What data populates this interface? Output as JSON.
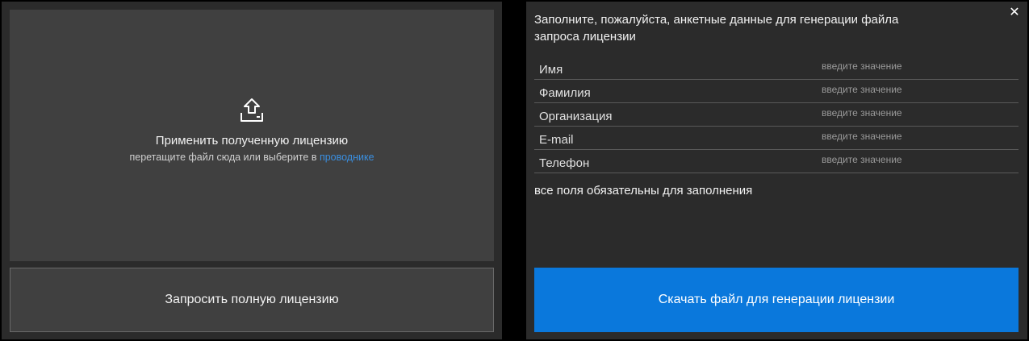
{
  "left_panel": {
    "dropzone": {
      "icon": "upload-icon",
      "title": "Применить полученную лицензию",
      "hint": "перетащите файл сюда или выберите в ",
      "link": "проводнике"
    },
    "request_button": "Запросить полную лицензию"
  },
  "right_panel": {
    "close_icon": "close-icon",
    "close_glyph": "✕",
    "title": "Заполните, пожалуйста, анкетные данные для генерации файла запроса лицензии",
    "fields": [
      {
        "label": "Имя",
        "placeholder": "введите значение",
        "value": ""
      },
      {
        "label": "Фамилия",
        "placeholder": "введите значение",
        "value": ""
      },
      {
        "label": "Организация",
        "placeholder": "введите значение",
        "value": ""
      },
      {
        "label": "E-mail",
        "placeholder": "введите значение",
        "value": ""
      },
      {
        "label": "Телефон",
        "placeholder": "введите значение",
        "value": ""
      }
    ],
    "required_note": "все поля обязательны для заполнения",
    "download_button": "Скачать файл для генерации лицензии"
  },
  "colors": {
    "background": "#000000",
    "panel": "#2b2b2b",
    "dropzone": "#404040",
    "accent": "#0a78dc",
    "link": "#3a8fe0"
  }
}
